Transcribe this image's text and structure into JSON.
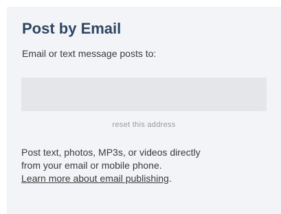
{
  "post_by_email": {
    "title": "Post by Email",
    "subtitle": "Email or text message posts to:",
    "address_value": "",
    "reset_label": "reset this address",
    "description_line1": "Post text, photos, MP3s, or videos directly",
    "description_line2": "from your email or mobile phone.",
    "learn_more_label": "Learn more about email publishing",
    "learn_more_suffix": "."
  },
  "colors": {
    "panel_background": "#f3f4f8",
    "title": "#2c4663",
    "field_background": "#e5e6e9",
    "muted_text": "#9a9a9a"
  }
}
